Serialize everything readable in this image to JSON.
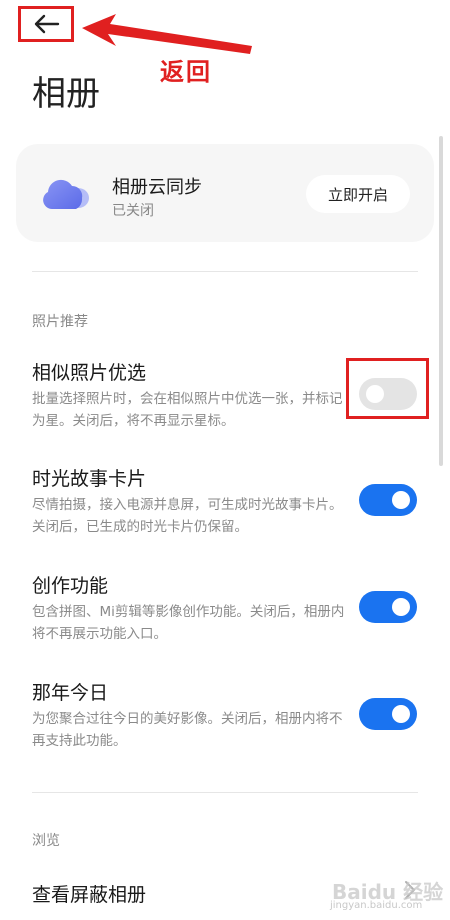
{
  "header": {
    "title": "相册",
    "back_icon": "arrow-left-icon"
  },
  "annotation": {
    "back_label": "返回",
    "color": "#e02020"
  },
  "cloud_sync": {
    "title": "相册云同步",
    "status": "已关闭",
    "button_label": "立即开启",
    "icon": "cloud-icon",
    "icon_color": "#6f7ef0"
  },
  "sections": {
    "photo_recommend": "照片推荐",
    "browse": "浏览"
  },
  "settings": [
    {
      "title": "相似照片优选",
      "desc": "批量选择照片时，会在相似照片中优选一张，并标记为星。关闭后，将不再显示星标。",
      "enabled": false
    },
    {
      "title": "时光故事卡片",
      "desc": "尽情拍摄，接入电源并息屏，可生成时光故事卡片。关闭后，已生成的时光卡片仍保留。",
      "enabled": true
    },
    {
      "title": "创作功能",
      "desc": "包含拼图、Mi剪辑等影像创作功能。关闭后，相册内将不再展示功能入口。",
      "enabled": true
    },
    {
      "title": "那年今日",
      "desc": "为您聚合过往今日的美好影像。关闭后，相册内将不再支持此功能。",
      "enabled": true
    }
  ],
  "browse_items": [
    {
      "title": "查看屏蔽相册"
    }
  ],
  "watermark": {
    "text": "Baidu 经验",
    "sub": "jingyan.baidu.com"
  },
  "colors": {
    "accent": "#1a73f0",
    "toggle_off": "#e4e4e4",
    "card_bg": "#f6f6f6"
  }
}
